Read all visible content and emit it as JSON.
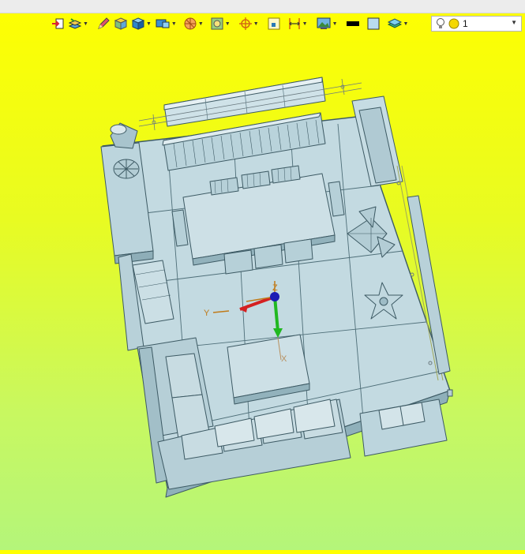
{
  "window": {
    "title_strip": ""
  },
  "toolbar": {
    "buttons": [
      {
        "icon": "import-icon",
        "dropdown": false
      },
      {
        "icon": "layer-stack-icon",
        "dropdown": true
      },
      {
        "icon": "pencil-icon",
        "dropdown": false
      },
      {
        "icon": "cube-texture-icon",
        "dropdown": false
      },
      {
        "icon": "cube-blue-icon",
        "dropdown": true
      },
      {
        "icon": "view-display-icon",
        "dropdown": true
      },
      {
        "icon": "section-sphere-icon",
        "dropdown": true
      },
      {
        "icon": "render-style-icon",
        "dropdown": true
      },
      {
        "icon": "snap-target-icon",
        "dropdown": true
      },
      {
        "icon": "grid-box-icon",
        "dropdown": false
      },
      {
        "icon": "dimension-icon",
        "dropdown": true
      },
      {
        "icon": "background-image-icon",
        "dropdown": true
      },
      {
        "icon": "black-line-icon",
        "dropdown": false
      },
      {
        "icon": "color-swatch-icon",
        "dropdown": false
      },
      {
        "icon": "layer-display-icon",
        "dropdown": true
      }
    ],
    "colors": {
      "swatch": "#b9dcf0",
      "line": "#000000"
    }
  },
  "light_combo": {
    "value": "1",
    "icons": [
      "light-bulb-icon",
      "yellow-circle-icon"
    ]
  },
  "axes": {
    "z": "Z",
    "y": "Y",
    "x": "X"
  },
  "colors": {
    "model": "#c8dde3",
    "model_dark": "#9ebcc6",
    "edge": "#3d5a64",
    "axis_x": "#d42020",
    "axis_y": "#6f4c0a",
    "axis_z": "#20b820",
    "origin": "#1b1bb4"
  }
}
